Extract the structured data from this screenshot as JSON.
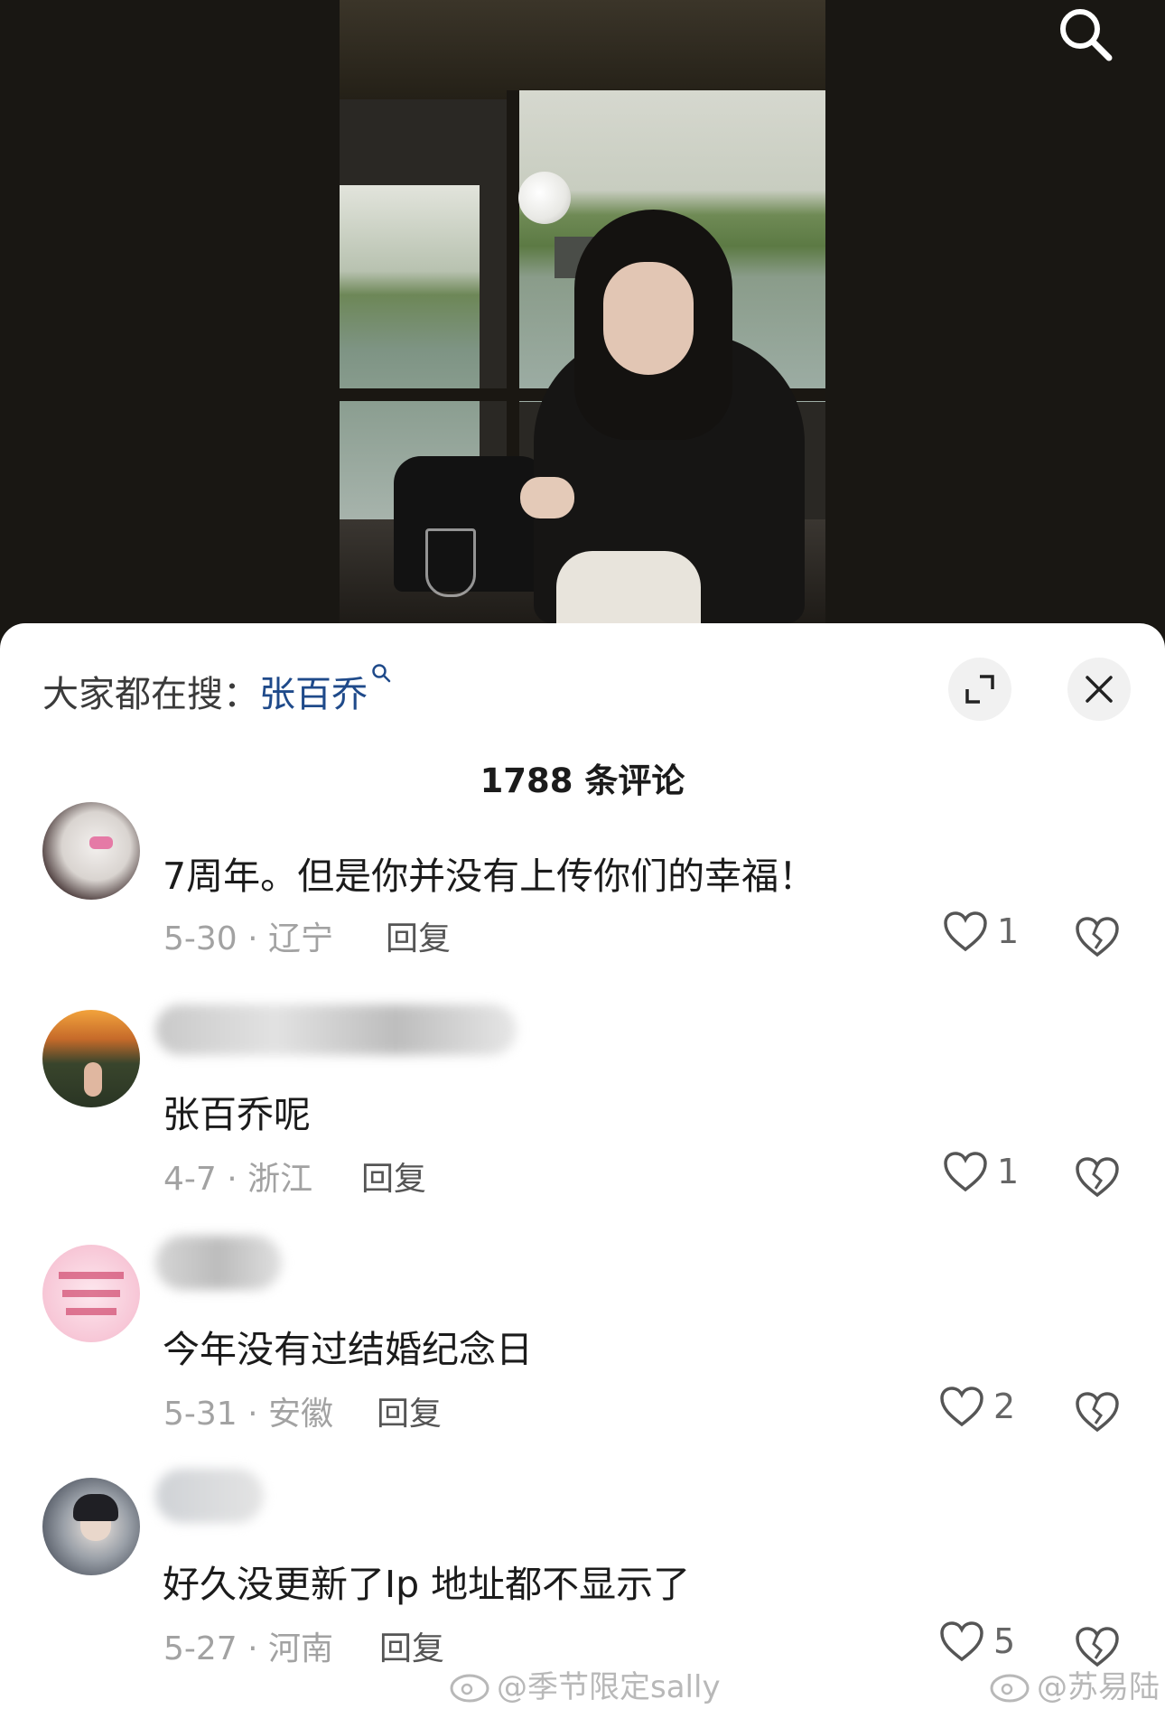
{
  "header": {
    "search_icon": "search-icon"
  },
  "sheet": {
    "trending_prefix": "大家都在搜：",
    "trending_term": "张百乔",
    "comment_count": "1788 条评论",
    "expand_icon": "expand-icon",
    "close_icon": "close-icon"
  },
  "comments": [
    {
      "text": "7周年。但是你并没有上传你们的幸福！",
      "meta": "5-30 · 辽宁",
      "reply_label": "回复",
      "likes": "1"
    },
    {
      "text": "张百乔呢",
      "meta": "4-7 · 浙江",
      "reply_label": "回复",
      "likes": "1"
    },
    {
      "text": "今年没有过结婚纪念日",
      "meta": "5-31 · 安徽",
      "reply_label": "回复",
      "likes": "2"
    },
    {
      "text": "好久没更新了Ip 地址都不显示了",
      "meta": "5-27 · 河南",
      "reply_label": "回复",
      "likes": "5"
    }
  ],
  "watermarks": {
    "left": "@季节限定sally",
    "right": "@苏易陆"
  }
}
